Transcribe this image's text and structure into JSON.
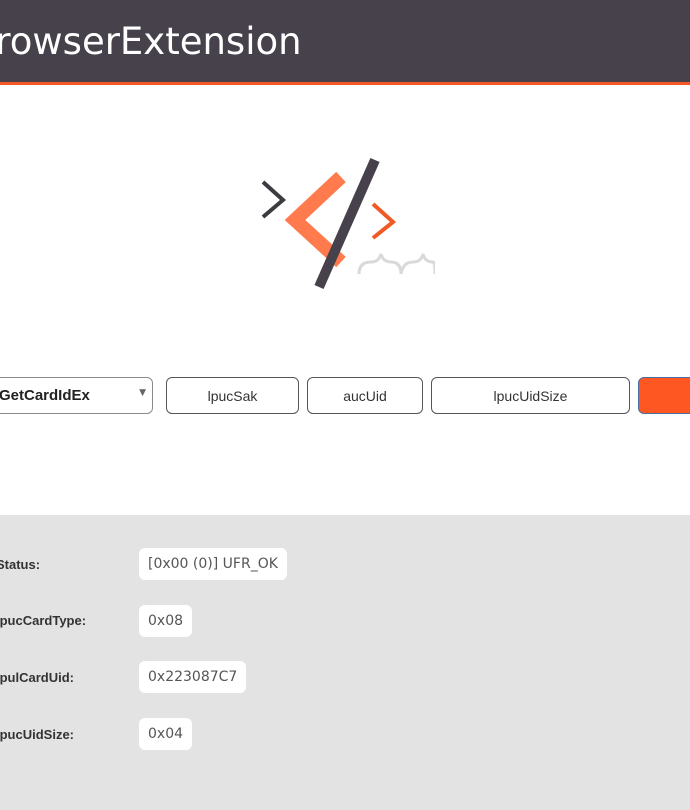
{
  "header": {
    "title": "BrowserExtension"
  },
  "controls": {
    "function_select": {
      "value": "GetCardIdEx"
    },
    "buttons": [
      "lpucSak",
      "aucUid",
      "lpucUidSize"
    ]
  },
  "results": [
    {
      "label": "Status:",
      "value": "[0x00 (0)] UFR_OK"
    },
    {
      "label": "lpucCardType:",
      "value": "0x08"
    },
    {
      "label": "lpulCardUid:",
      "value": "0x223087C7"
    },
    {
      "label": "lpucUidSize:",
      "value": "0x04"
    }
  ],
  "colors": {
    "header_bg": "#46414a",
    "accent": "#f15a24",
    "panel_bg": "#e3e3e3"
  }
}
